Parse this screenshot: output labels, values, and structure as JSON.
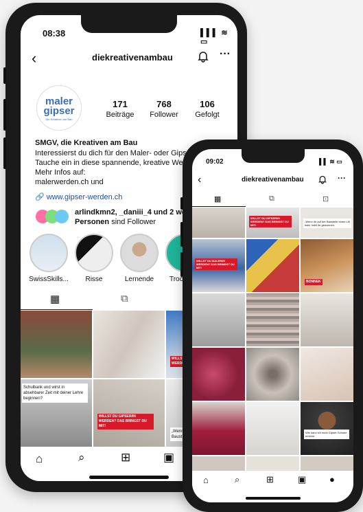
{
  "phone1": {
    "status": {
      "time": "08:38",
      "icons": "▌▌▌ ≋ ▭"
    },
    "header": {
      "back": "‹",
      "handle": "diekreativenambau",
      "bell": "🔔",
      "more": "···"
    },
    "avatar": {
      "logo_main": "maler\ngipser",
      "logo_sub": "Die Kreativen am Bau"
    },
    "stats": [
      {
        "num": "171",
        "label": "Beiträge"
      },
      {
        "num": "768",
        "label": "Follower"
      },
      {
        "num": "106",
        "label": "Gefolgt"
      }
    ],
    "bio": {
      "name": "SMGV, die Kreativen am Bau",
      "lines": [
        "Interessierst du dich für den Maler- oder Gipser-Beruf?",
        "Tauche ein in diese spannende, kreative Welt!",
        "Mehr Infos auf:",
        "malerwerden.ch und"
      ],
      "link": "www.gipser-werden.ch"
    },
    "followed_by": {
      "line1": "arlindkmn2, _daniii_4 und 2 weitere",
      "line2_bold": "Personen",
      "line2_rest": " sind Follower"
    },
    "highlights": [
      {
        "label": "SwissSkills..."
      },
      {
        "label": "Risse"
      },
      {
        "label": "Lernende"
      },
      {
        "label": "Trocken..."
      }
    ],
    "tabs": {
      "grid": "▦",
      "reels": "⧉"
    },
    "posts": [
      {
        "banner": ""
      },
      {
        "banner": ""
      },
      {
        "banner": "WILLST DU MALER/IN WERDEN? ZU..."
      },
      {
        "text": "Schulbank und wirst in absehbarer Zeit mit deiner Lehre beginnen?"
      },
      {
        "banner": "WILLST DU GIPSER/IN WERDEN? DAS BRINGST DU MIT!"
      },
      {
        "text": "„Wenn... Baust..."
      }
    ],
    "nav": {
      "home": "⌂",
      "search": "⌕",
      "add": "⊞",
      "reels": "▣"
    }
  },
  "phone2": {
    "status": {
      "time": "09:02",
      "icons": "▌▌ ≋ ▭"
    },
    "header": {
      "back": "‹",
      "handle": "diekreativenambau",
      "bell": "🔔",
      "more": "···"
    },
    "tabs": {
      "grid": "▦",
      "reels": "⧉",
      "tagged": "⊡"
    },
    "posts": [
      {
        "banner": ""
      },
      {
        "banner": "WILLST DU GIPSER/IN WERDEN? DAS BRINGST DU MIT!"
      },
      {
        "text": "„Wenn ihr auf der Baustelle einen Lift habt, habt ihr gewonnen."
      },
      {
        "banner": ""
      },
      {
        "banner": ""
      },
      {
        "banner": ""
      },
      {
        "banner": "WILLST DU MALER/IN WERDEN? DAS BRINGST DU MIT!"
      },
      {
        "banner": ""
      },
      {
        "banner": "BONNEK"
      },
      {
        "banner": ""
      },
      {
        "banner": ""
      },
      {
        "banner": ""
      },
      {
        "banner": ""
      },
      {
        "banner": ""
      },
      {
        "banner": ""
      },
      {
        "banner": ""
      },
      {
        "banner": ""
      },
      {
        "text": "Wie kann ich mein Gipser-Schuhe erreicht."
      }
    ],
    "nav": {
      "home": "⌂",
      "search": "⌕",
      "add": "⊞",
      "reels": "▣",
      "profile": "●"
    }
  },
  "colors": {
    "brand_blue": "#3a6fb8",
    "accent_red": "#d7192a",
    "link_blue": "#1d4f9a"
  }
}
